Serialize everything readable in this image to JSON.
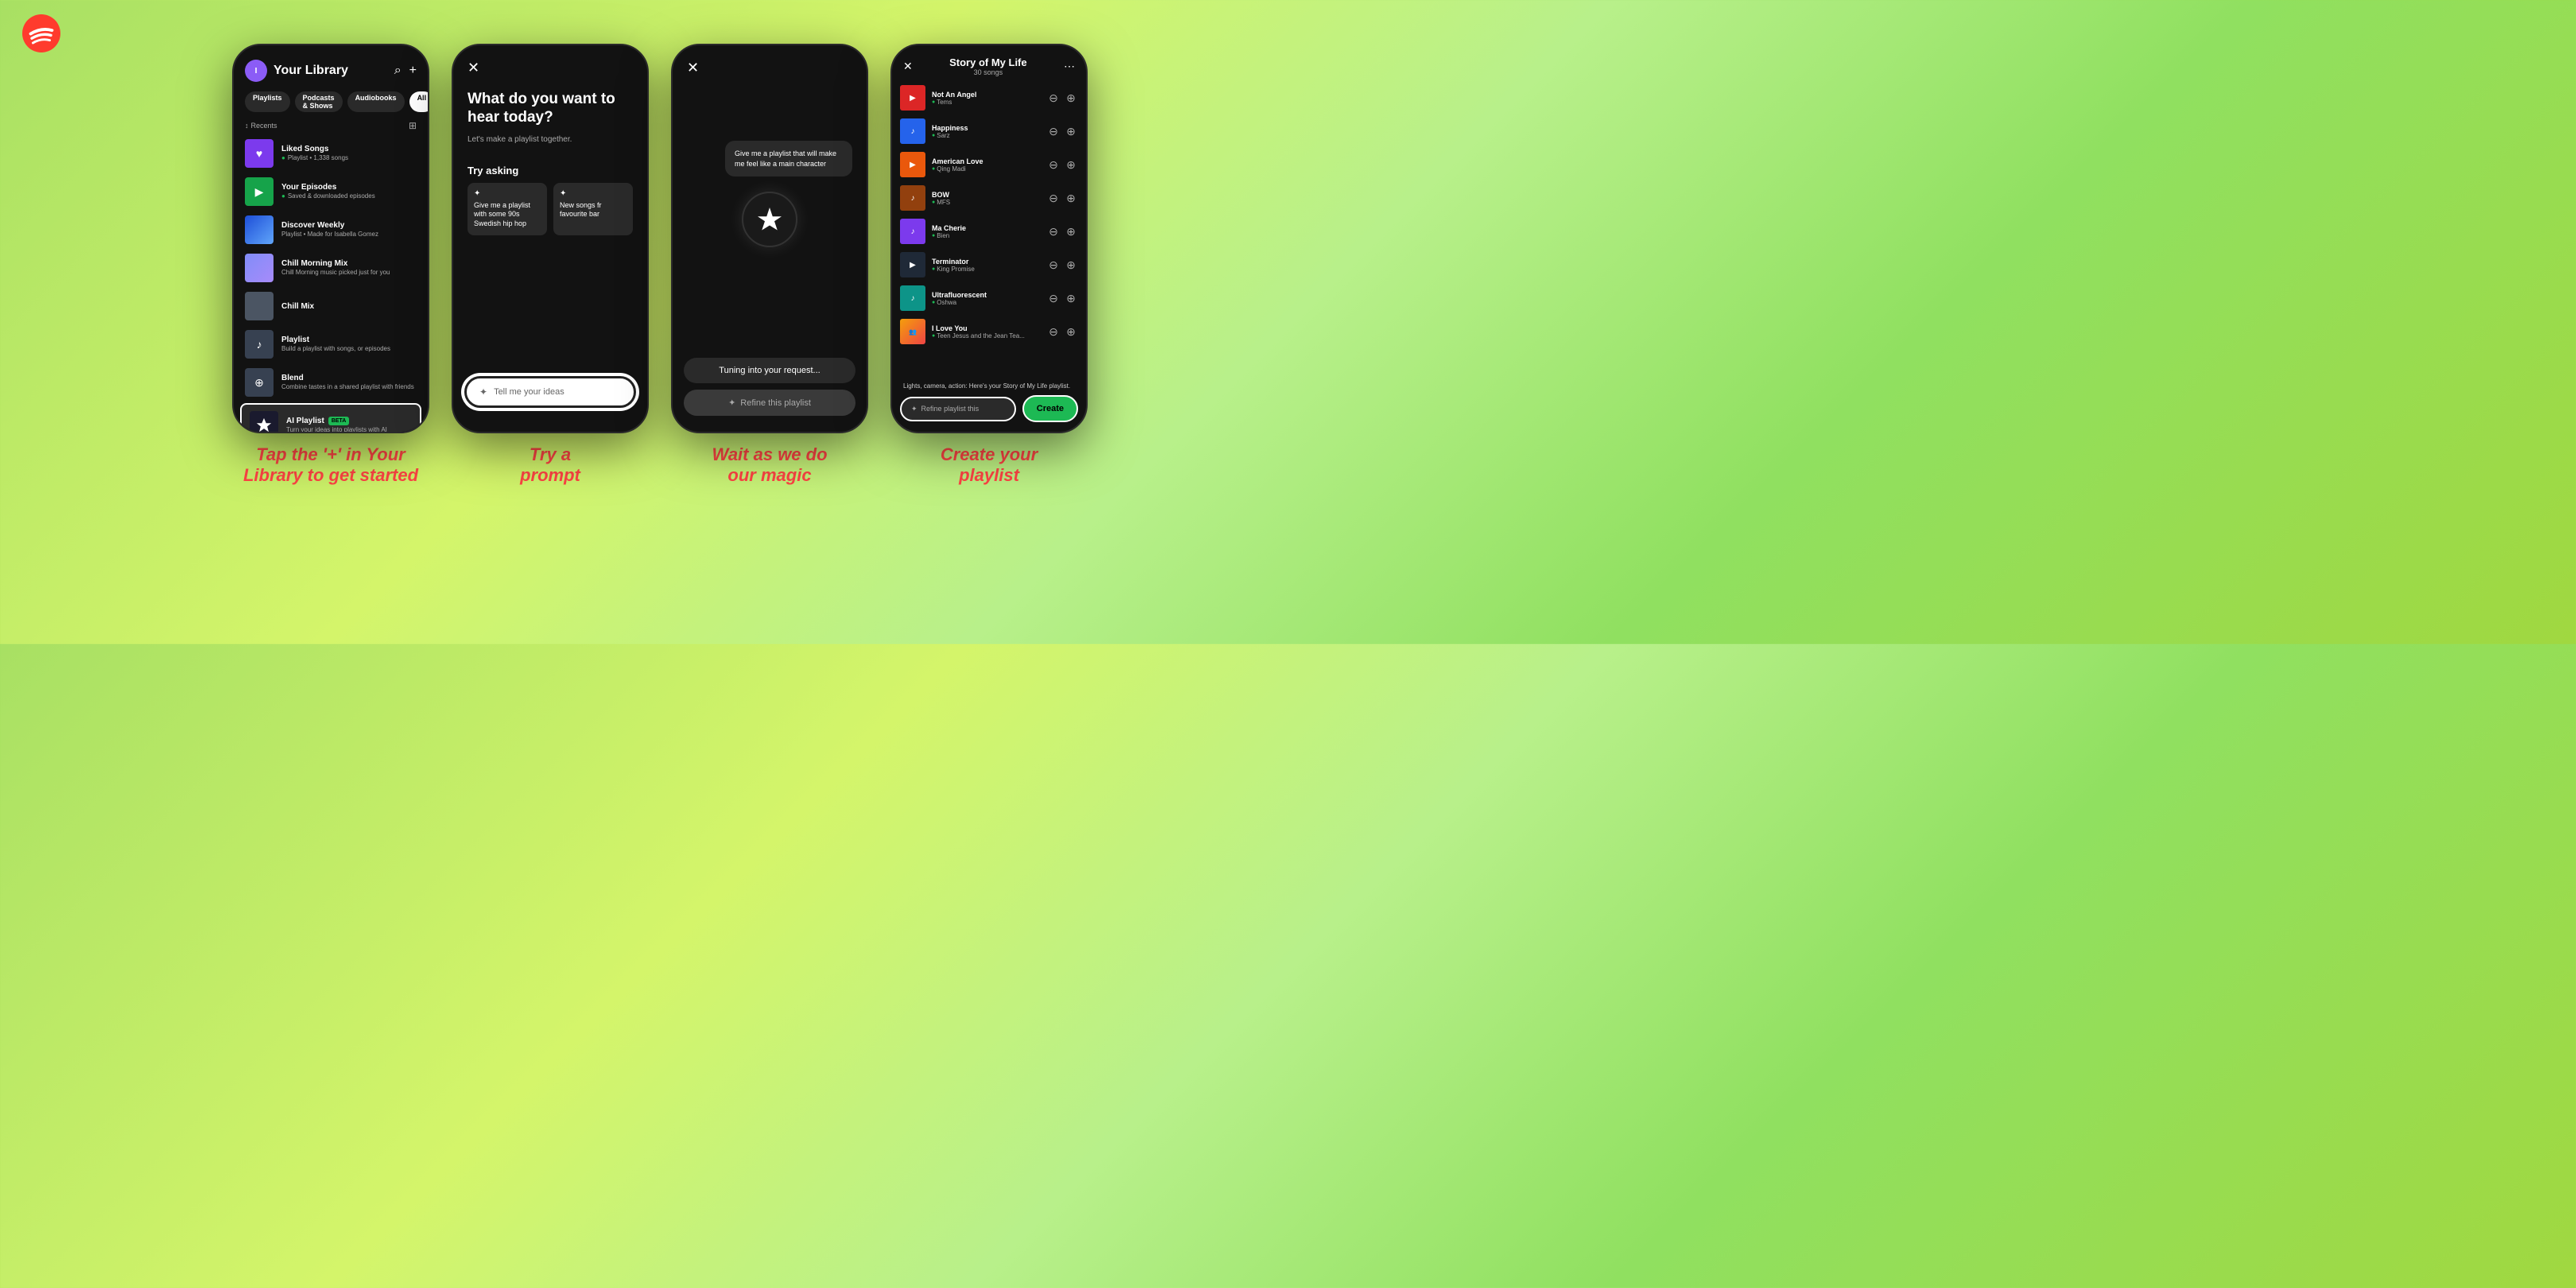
{
  "app": {
    "name": "Spotify",
    "logo_color": "#1db954"
  },
  "phones": [
    {
      "id": "phone1",
      "screen": "library",
      "header": {
        "title": "Your Library",
        "search_icon": "search",
        "add_icon": "plus"
      },
      "filters": [
        "Playlists",
        "Podcasts & Shows",
        "Audiobooks",
        "All"
      ],
      "sort": "Recents",
      "items": [
        {
          "title": "Liked Songs",
          "sub": "Playlist • 1,338 songs",
          "type": "liked",
          "color": "purple"
        },
        {
          "title": "Your Episodes",
          "sub": "Saved & downloaded episodes",
          "type": "episodes",
          "color": "green"
        },
        {
          "title": "Discover Weekly",
          "sub": "Playlist • Made for Isabella Gomez",
          "type": "discover",
          "color": "blue"
        },
        {
          "title": "Chill Morning Mix",
          "sub": "Chill Morning music picked just for you",
          "type": "mix",
          "color": "gradient"
        },
        {
          "title": "Chill Mix",
          "type": "chill",
          "color": "gray"
        },
        {
          "title": "Playlist",
          "sub": "Build a playlist with songs, or episodes",
          "type": "playlist",
          "color": "dark-gray"
        },
        {
          "title": "Blend",
          "sub": "Combine tastes in a shared playlist with friends",
          "type": "blend",
          "color": "dark-gray"
        }
      ],
      "ai_item": {
        "title": "AI Playlist",
        "beta": "BETA",
        "sub": "Turn your ideas into playlists with AI"
      }
    },
    {
      "id": "phone2",
      "screen": "ai-prompt",
      "question": "What do you want to hear today?",
      "sub": "Let's make a playlist together.",
      "try_asking_label": "Try asking",
      "suggestions": [
        "Give me a playlist with some 90s Swedish hip hop",
        "New songs fr favourite bar"
      ],
      "input_placeholder": "Tell me your ideas"
    },
    {
      "id": "phone3",
      "screen": "ai-loading",
      "request_text": "Give me a playlist that will make me feel like a main character",
      "tuning_text": "Tuning into your request...",
      "refine_text": "Refine this playlist"
    },
    {
      "id": "phone4",
      "screen": "playlist-result",
      "playlist_title": "Story of My Life",
      "playlist_subtitle": "30 songs",
      "songs": [
        {
          "title": "Not An Angel",
          "artist": "Tems",
          "color": "c-red"
        },
        {
          "title": "Happiness",
          "artist": "Sarz",
          "color": "c-blue"
        },
        {
          "title": "American Love",
          "artist": "Qing Madi",
          "color": "c-orange"
        },
        {
          "title": "BOW",
          "artist": "MFS",
          "color": "c-brown"
        },
        {
          "title": "Ma Cherie",
          "artist": "Bien",
          "color": "c-purple"
        },
        {
          "title": "Terminator",
          "artist": "King Promise",
          "color": "c-dark"
        },
        {
          "title": "Ultrafluorescent",
          "artist": "Oshwa",
          "color": "c-teal"
        },
        {
          "title": "I Love You",
          "artist": "Teen Jesus and the Jean Tea...",
          "color": "c-multi"
        }
      ],
      "description": "Lights, camera, action: Here's your Story of My Life playlist.",
      "refine_placeholder": "Refine playlist this",
      "create_label": "Create"
    }
  ],
  "step_labels": [
    "Tap the '+' in Your\nLibrary to get started",
    "Try a\nprompt",
    "Wait as we do\nour magic",
    "Create your\nplaylist"
  ]
}
